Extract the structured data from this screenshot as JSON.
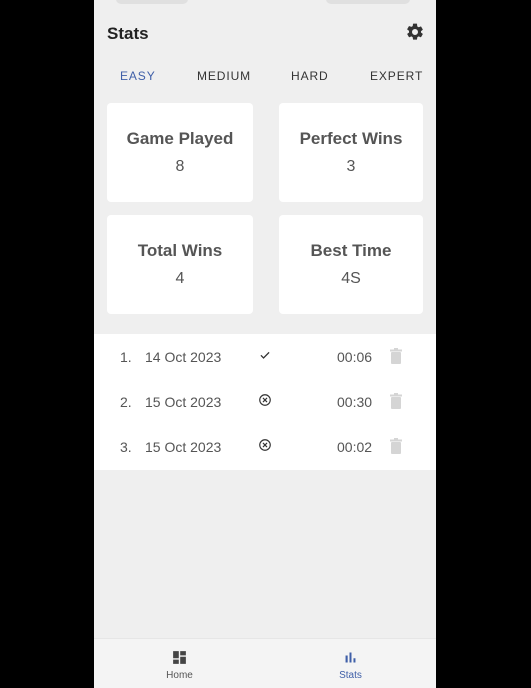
{
  "header": {
    "title": "Stats"
  },
  "tabs": [
    {
      "label": "EASY",
      "active": true
    },
    {
      "label": "MEDIUM",
      "active": false
    },
    {
      "label": "HARD",
      "active": false
    },
    {
      "label": "EXPERT",
      "active": false
    }
  ],
  "cards": [
    {
      "label": "Game Played",
      "value": "8"
    },
    {
      "label": "Perfect Wins",
      "value": "3"
    },
    {
      "label": "Total Wins",
      "value": "4"
    },
    {
      "label": "Best Time",
      "value": "4S"
    }
  ],
  "history": [
    {
      "index": "1.",
      "date": "14 Oct 2023",
      "status_icon": "check-icon",
      "time": "00:06"
    },
    {
      "index": "2.",
      "date": "15 Oct 2023",
      "status_icon": "cancel-circle-icon",
      "time": "00:30"
    },
    {
      "index": "3.",
      "date": "15 Oct 2023",
      "status_icon": "cancel-circle-icon",
      "time": "00:02"
    }
  ],
  "nav": [
    {
      "label": "Home",
      "icon": "dashboard-icon",
      "active": false
    },
    {
      "label": "Stats",
      "icon": "bar-chart-icon",
      "active": true
    }
  ],
  "colors": {
    "accent": "#3f5fa8",
    "background": "#efefef",
    "card": "#ffffff"
  }
}
